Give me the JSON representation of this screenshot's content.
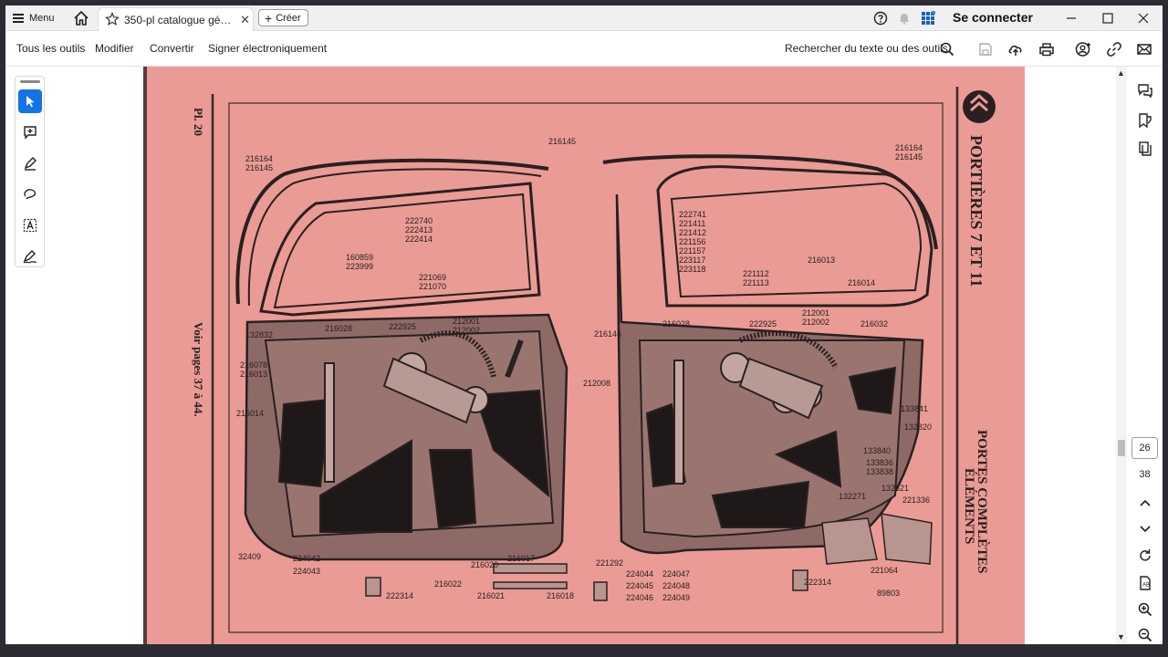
{
  "titlebar": {
    "menu_label": "Menu",
    "tab_title": "350-pl catalogue géné...",
    "create_label": "Créer",
    "signin_label": "Se connecter"
  },
  "toolbar": {
    "all_tools": "Tous les outils",
    "edit": "Modifier",
    "convert": "Convertir",
    "sign": "Signer électroniquement",
    "search": "Rechercher du texte ou des outils"
  },
  "navigation": {
    "current_page": "26",
    "total_pages": "38"
  },
  "document": {
    "plate_label": "Pl. 20",
    "see_pages": "Voir pages 37 à 44.",
    "title": "PORTIÈRES 7 ET 11",
    "subtitle1": "PORTES COMPLÈTES",
    "subtitle2": "ÉLÉMENTS",
    "parts": [
      "216164",
      "216145",
      "216145",
      "222740",
      "222413",
      "222414",
      "160859",
      "223999",
      "221069",
      "221070",
      "216028",
      "222925",
      "212001",
      "212002",
      "132832",
      "216078",
      "216013",
      "216014",
      "212008",
      "216146",
      "216164",
      "216145",
      "222741",
      "221411",
      "221412",
      "221156",
      "221157",
      "223117",
      "223118",
      "221112",
      "221113",
      "216013",
      "216014",
      "216028",
      "222925",
      "212001",
      "212002",
      "216032",
      "133841",
      "132820",
      "133840",
      "133836",
      "133838",
      "132621",
      "132271",
      "221336",
      "221064",
      "89803",
      "222314",
      "32409",
      "224042",
      "224043",
      "216020",
      "216022",
      "216021",
      "216017",
      "216018",
      "221292",
      "224044",
      "224047",
      "224045",
      "224048",
      "224046",
      "224049",
      "222314"
    ]
  },
  "colors": {
    "page_bg": "#ea9b95",
    "accent": "#1473e6"
  }
}
